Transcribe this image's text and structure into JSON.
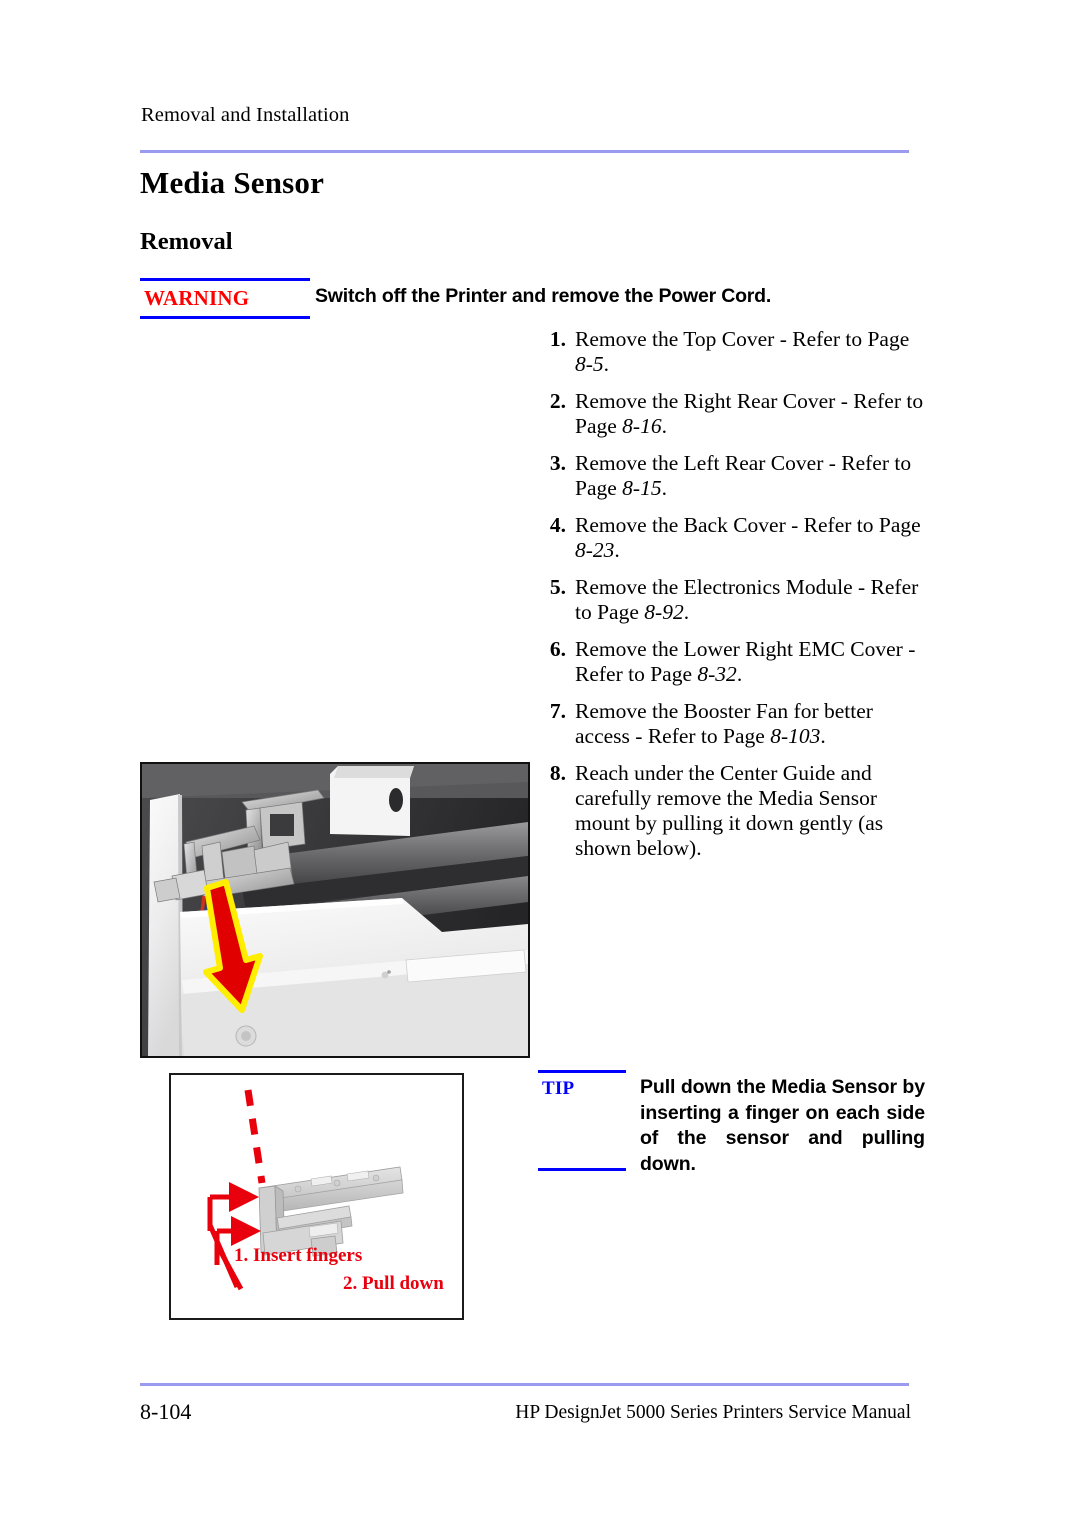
{
  "header": {
    "running_head": "Removal and Installation"
  },
  "titles": {
    "chapter": "Media Sensor",
    "section": "Removal"
  },
  "warning": {
    "tag": "WARNING",
    "text": "Switch off the Printer and remove the Power Cord.",
    "tag_color": "#ff0000",
    "rule_color": "#0000ff"
  },
  "tip": {
    "tag": "TIP",
    "text": "Pull down the Media Sensor by inserting a finger on each side of the sensor and pulling down.",
    "tag_color": "#0000ff",
    "rule_color": "#0000ff"
  },
  "steps": [
    {
      "num": "1.",
      "text": "Remove the Top Cover - Refer to Page ",
      "ref": "8-5",
      "tail": "."
    },
    {
      "num": "2.",
      "text": "Remove the Right Rear Cover - Refer to Page ",
      "ref": "8-16",
      "tail": "."
    },
    {
      "num": "3.",
      "text": "Remove the Left Rear Cover - Refer to Page ",
      "ref": "8-15",
      "tail": "."
    },
    {
      "num": "4.",
      "text": "Remove the Back Cover - Refer to Page ",
      "ref": "8-23",
      "tail": "."
    },
    {
      "num": "5.",
      "text": "Remove the Electronics Module - Refer to Page ",
      "ref": "8-92",
      "tail": "."
    },
    {
      "num": "6.",
      "text": "Remove the Lower Right EMC Cover - Refer to Page ",
      "ref": "8-32",
      "tail": "."
    },
    {
      "num": "7.",
      "text": "Remove the Booster Fan for better access - Refer to Page ",
      "ref": "8-103",
      "tail": "."
    },
    {
      "num": "8.",
      "text": "Reach under the Center Guide and carefully remove the Media Sensor mount by pulling it down gently (as shown below).",
      "ref": "",
      "tail": ""
    }
  ],
  "photo": {
    "caption": "",
    "arrow_color": "#e00000",
    "arrow_outline": "#ffee00"
  },
  "diagram": {
    "labels": [
      {
        "id": "insert",
        "text": "1. Insert fingers"
      },
      {
        "id": "pull",
        "text": "2. Pull down"
      }
    ],
    "arrow_color": "#e8000d",
    "part_color": "#d2d2d2"
  },
  "footer": {
    "folio": "8-104",
    "manual_title": "HP DesignJet 5000 Series Printers Service Manual",
    "rule_color": "#9a9aee"
  }
}
